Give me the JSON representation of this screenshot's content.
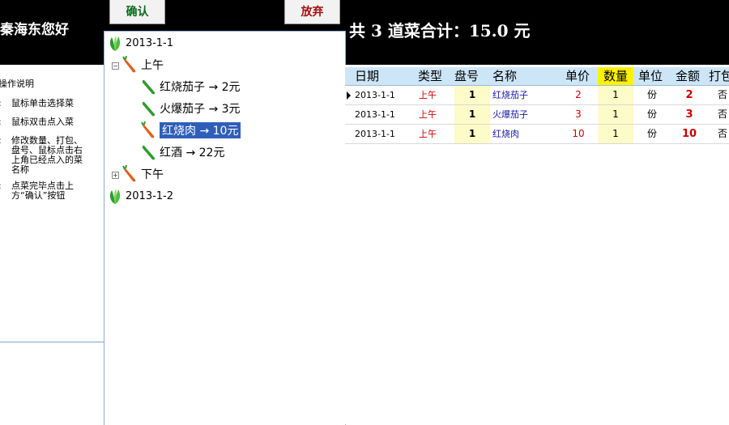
{
  "header": {
    "greeting": "秦海东您好",
    "confirm_label": "确认",
    "discard_label": "放弃",
    "summary_text": "共 3 道菜合计：15.0 元"
  },
  "help": {
    "title": "操作说明",
    "items": [
      {
        "num": ":",
        "text": "鼠标单击选择菜"
      },
      {
        "num": ":",
        "text": "鼠标双击点入菜"
      },
      {
        "num": ":",
        "text": "修改数量、打包、盘号、鼠标点击右上角已经点入的菜名称"
      },
      {
        "num": ":",
        "text": "点菜完毕点击上方“确认”按钮"
      }
    ]
  },
  "tree": {
    "date1": "2013-1-1",
    "am": "上午",
    "items": [
      "红烧茄子 → 2元",
      "火爆茄子 → 3元",
      "红烧肉 → 10元",
      "红酒 → 22元"
    ],
    "pm": "下午",
    "date2": "2013-1-2",
    "expander_open": "−",
    "expander_closed": "+"
  },
  "grid": {
    "headers": {
      "date": "日期",
      "type": "类型",
      "plate": "盘号",
      "name": "名称",
      "price": "单价",
      "qty": "数量",
      "unit": "单位",
      "amount": "金额",
      "pack": "打包"
    },
    "rows": [
      {
        "date": "2013-1-1",
        "type": "上午",
        "plate": "1",
        "name": "红烧茄子",
        "price": "2",
        "qty": "1",
        "unit": "份",
        "amount": "2",
        "pack": "否"
      },
      {
        "date": "2013-1-1",
        "type": "上午",
        "plate": "1",
        "name": "火爆茄子",
        "price": "3",
        "qty": "1",
        "unit": "份",
        "amount": "3",
        "pack": "否"
      },
      {
        "date": "2013-1-1",
        "type": "上午",
        "plate": "1",
        "name": "红烧肉",
        "price": "10",
        "qty": "1",
        "unit": "份",
        "amount": "10",
        "pack": "否"
      }
    ]
  },
  "icons": {
    "date": "vegetable-icon",
    "session": "carrot-icon",
    "dish_green": "cucumber-icon",
    "dish_orange": "carrot-icon"
  },
  "colors": {
    "header_bg": "#000000",
    "grid_header_bg": "#cde6f7",
    "qty_highlight": "#fff200",
    "selection": "#2f5fb8"
  }
}
